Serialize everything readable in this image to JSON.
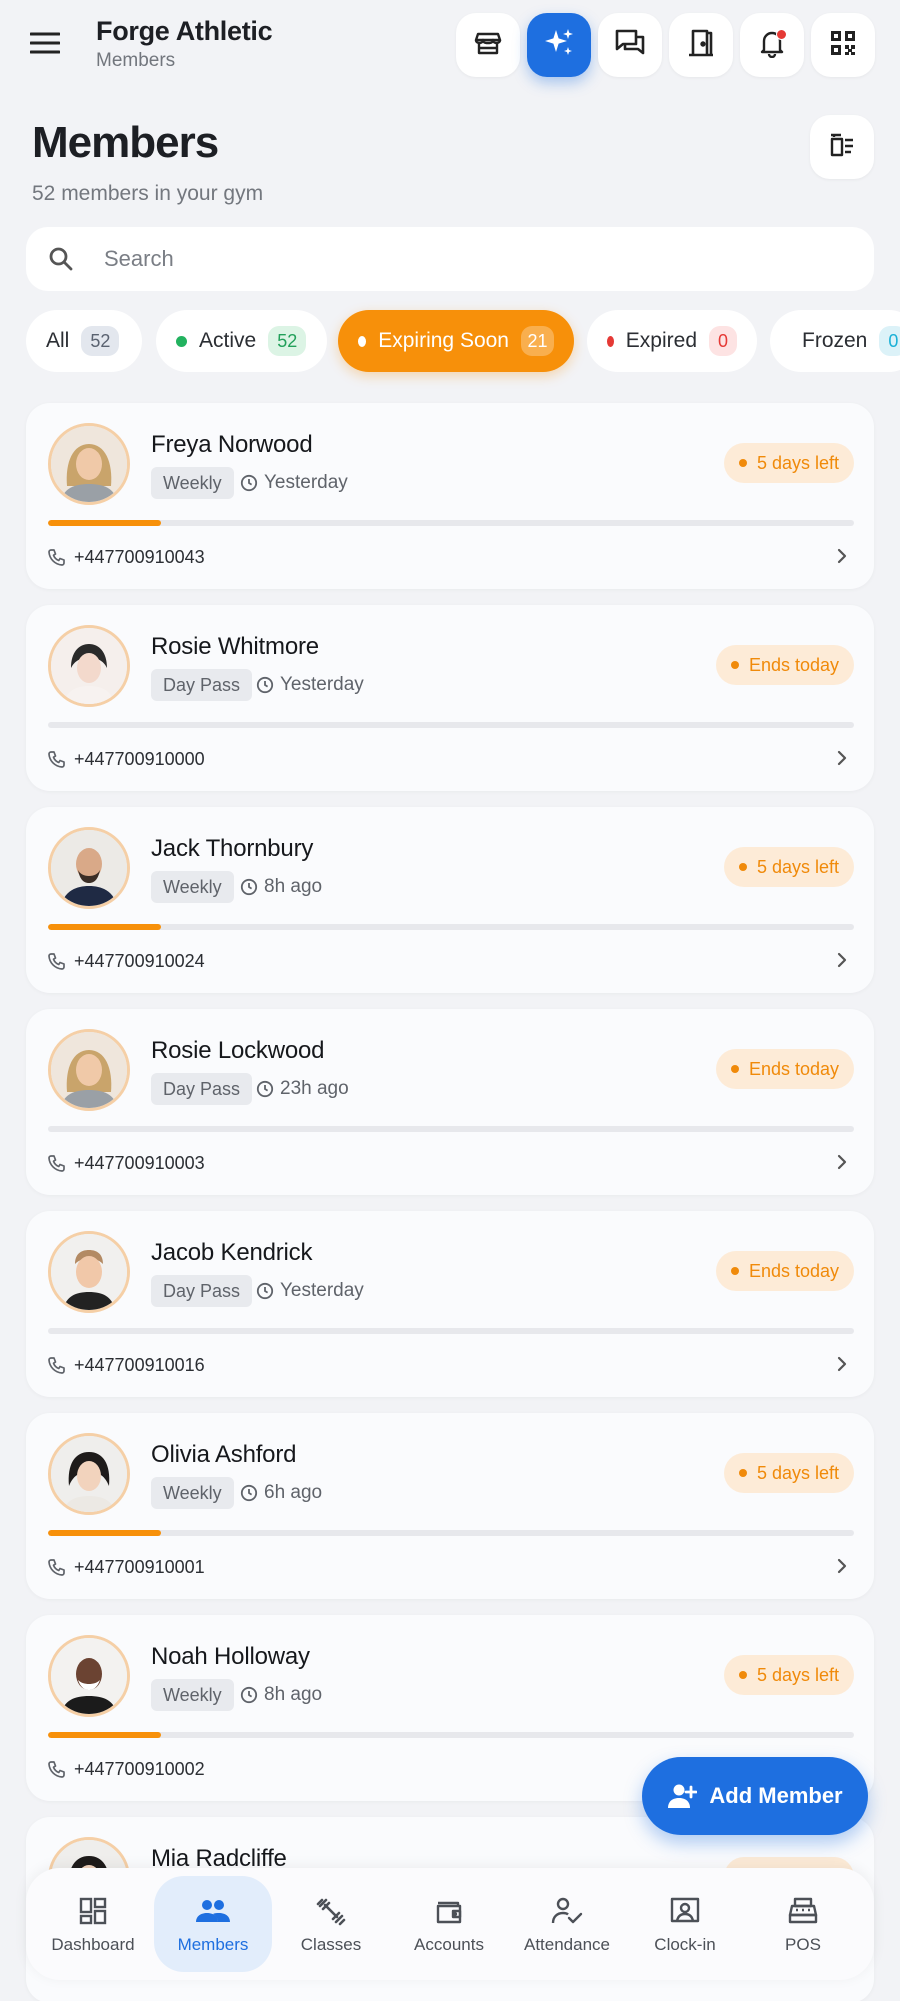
{
  "header": {
    "title": "Forge Athletic",
    "subtitle": "Members",
    "menu_icon": "hamburger-icon",
    "actions": [
      "store-icon",
      "sparkle-icon",
      "chat-icon",
      "door-icon",
      "bell-icon",
      "qr-code-icon"
    ]
  },
  "page": {
    "title": "Members",
    "subtitle": "52 members in your gym"
  },
  "search": {
    "placeholder": "Search"
  },
  "filters": [
    {
      "label": "All",
      "count": "52",
      "dot": null
    },
    {
      "label": "Active",
      "count": "52",
      "dot": "#22b25f"
    },
    {
      "label": "Expiring Soon",
      "count": "21",
      "dot": "#ffffff"
    },
    {
      "label": "Expired",
      "count": "0",
      "dot": "#e53935"
    },
    {
      "label": "Frozen",
      "count": "0",
      "dot": "#1ab0d6"
    }
  ],
  "members": [
    {
      "name": "Freya Norwood",
      "plan": "Weekly",
      "last_seen": "Yesterday",
      "status": "5 days left",
      "progress": 0.14,
      "phone": "+447700910043"
    },
    {
      "name": "Rosie Whitmore",
      "plan": "Day Pass",
      "last_seen": "Yesterday",
      "status": "Ends today",
      "progress": 0,
      "phone": "+447700910000"
    },
    {
      "name": "Jack Thornbury",
      "plan": "Weekly",
      "last_seen": "8h ago",
      "status": "5 days left",
      "progress": 0.14,
      "phone": "+447700910024"
    },
    {
      "name": "Rosie Lockwood",
      "plan": "Day Pass",
      "last_seen": "23h ago",
      "status": "Ends today",
      "progress": 0,
      "phone": "+447700910003"
    },
    {
      "name": "Jacob Kendrick",
      "plan": "Day Pass",
      "last_seen": "Yesterday",
      "status": "Ends today",
      "progress": 0,
      "phone": "+447700910016"
    },
    {
      "name": "Olivia Ashford",
      "plan": "Weekly",
      "last_seen": "6h ago",
      "status": "5 days left",
      "progress": 0.14,
      "phone": "+447700910001"
    },
    {
      "name": "Noah Holloway",
      "plan": "Weekly",
      "last_seen": "8h ago",
      "status": "5 days left",
      "progress": 0.14,
      "phone": "+447700910002"
    },
    {
      "name": "Mia Radcliffe",
      "plan": "",
      "last_seen": "",
      "status": "",
      "progress": 0,
      "phone": ""
    }
  ],
  "fab": {
    "label": "Add Member"
  },
  "bottom_nav": [
    {
      "label": "Dashboard",
      "icon": "dashboard-icon"
    },
    {
      "label": "Members",
      "icon": "members-icon"
    },
    {
      "label": "Classes",
      "icon": "dumbbell-icon"
    },
    {
      "label": "Accounts",
      "icon": "wallet-icon"
    },
    {
      "label": "Attendance",
      "icon": "attendance-icon"
    },
    {
      "label": "Clock-in",
      "icon": "clock-in-icon"
    },
    {
      "label": "POS",
      "icon": "pos-icon"
    }
  ],
  "colors": {
    "primary": "#1e6fe0",
    "accent_orange": "#f7900a",
    "badge_bg": "#fdebd7"
  }
}
